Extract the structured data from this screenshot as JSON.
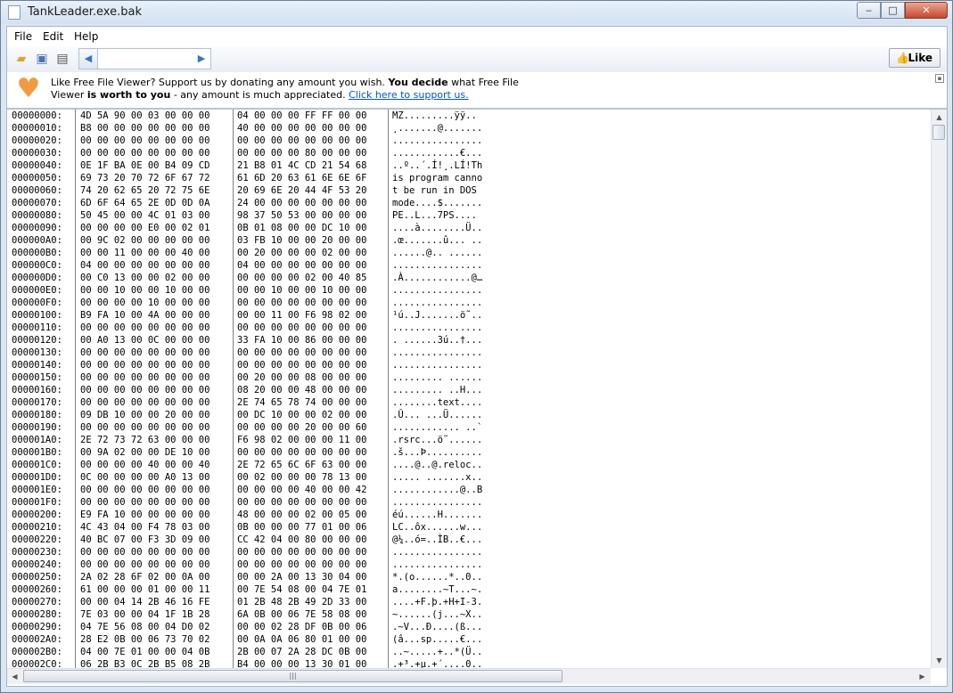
{
  "window": {
    "title": "TankLeader.exe.bak",
    "min": "‒",
    "max": "□",
    "close": "✕"
  },
  "menu": [
    "File",
    "Edit",
    "Help"
  ],
  "toolbar": {
    "like_label": "Like",
    "nav_prev": "◀",
    "nav_next": "▶"
  },
  "banner": {
    "p1": "Like Free File Viewer? Support us by donating any amount you wish.",
    "b1": "You decide",
    "p2": "what Free File",
    "p3": "Viewer",
    "b2": "is worth to you",
    "p4": "- any amount is much appreciated.",
    "link": "Click here to support us."
  },
  "hex_rows": [
    {
      "off": "00000000:",
      "h1": "4D 5A 90 00 03 00 00 00",
      "h2": "04 00 00 00 FF FF 00 00",
      "a": "MZ.........ÿÿ.."
    },
    {
      "off": "00000010:",
      "h1": "B8 00 00 00 00 00 00 00",
      "h2": "40 00 00 00 00 00 00 00",
      "a": "¸.......@......."
    },
    {
      "off": "00000020:",
      "h1": "00 00 00 00 00 00 00 00",
      "h2": "00 00 00 00 00 00 00 00",
      "a": "................"
    },
    {
      "off": "00000030:",
      "h1": "00 00 00 00 00 00 00 00",
      "h2": "00 00 00 00 80 00 00 00",
      "a": "............€..."
    },
    {
      "off": "00000040:",
      "h1": "0E 1F BA 0E 00 B4 09 CD",
      "h2": "21 B8 01 4C CD 21 54 68",
      "a": "..º..´.Í!¸.LÍ!Th"
    },
    {
      "off": "00000050:",
      "h1": "69 73 20 70 72 6F 67 72",
      "h2": "61 6D 20 63 61 6E 6E 6F",
      "a": "is program canno"
    },
    {
      "off": "00000060:",
      "h1": "74 20 62 65 20 72 75 6E",
      "h2": "20 69 6E 20 44 4F 53 20",
      "a": "t be run in DOS "
    },
    {
      "off": "00000070:",
      "h1": "6D 6F 64 65 2E 0D 0D 0A",
      "h2": "24 00 00 00 00 00 00 00",
      "a": "mode....$......."
    },
    {
      "off": "00000080:",
      "h1": "50 45 00 00 4C 01 03 00",
      "h2": "98 37 50 53 00 00 00 00",
      "a": "PE..L...7PS...."
    },
    {
      "off": "00000090:",
      "h1": "00 00 00 00 E0 00 02 01",
      "h2": "0B 01 08 00 00 DC 10 00",
      "a": "....à........Ü.."
    },
    {
      "off": "000000A0:",
      "h1": "00 9C 02 00 00 00 00 00",
      "h2": "03 FB 10 00 00 20 00 00",
      "a": ".œ.......û... .."
    },
    {
      "off": "000000B0:",
      "h1": "00 00 11 00 00 00 40 00",
      "h2": "00 20 00 00 00 02 00 00",
      "a": "......@.. ......"
    },
    {
      "off": "000000C0:",
      "h1": "04 00 00 00 00 00 00 00",
      "h2": "04 00 00 00 00 00 00 00",
      "a": "................"
    },
    {
      "off": "000000D0:",
      "h1": "00 C0 13 00 00 02 00 00",
      "h2": "00 00 00 00 02 00 40 85",
      "a": ".À............@…"
    },
    {
      "off": "000000E0:",
      "h1": "00 00 10 00 00 10 00 00",
      "h2": "00 00 10 00 00 10 00 00",
      "a": "................"
    },
    {
      "off": "000000F0:",
      "h1": "00 00 00 00 10 00 00 00",
      "h2": "00 00 00 00 00 00 00 00",
      "a": "................"
    },
    {
      "off": "00000100:",
      "h1": "B9 FA 10 00 4A 00 00 00",
      "h2": "00 00 11 00 F6 98 02 00",
      "a": "¹ú..J.......ö˜.."
    },
    {
      "off": "00000110:",
      "h1": "00 00 00 00 00 00 00 00",
      "h2": "00 00 00 00 00 00 00 00",
      "a": "................"
    },
    {
      "off": "00000120:",
      "h1": "00 A0 13 00 0C 00 00 00",
      "h2": "33 FA 10 00 86 00 00 00",
      "a": ". ......3ú..†..."
    },
    {
      "off": "00000130:",
      "h1": "00 00 00 00 00 00 00 00",
      "h2": "00 00 00 00 00 00 00 00",
      "a": "................"
    },
    {
      "off": "00000140:",
      "h1": "00 00 00 00 00 00 00 00",
      "h2": "00 00 00 00 00 00 00 00",
      "a": "................"
    },
    {
      "off": "00000150:",
      "h1": "00 00 00 00 00 00 00 00",
      "h2": "00 20 00 00 08 00 00 00",
      "a": "......... ......"
    },
    {
      "off": "00000160:",
      "h1": "00 00 00 00 00 00 00 00",
      "h2": "08 20 00 00 48 00 00 00",
      "a": "......... ..H..."
    },
    {
      "off": "00000170:",
      "h1": "00 00 00 00 00 00 00 00",
      "h2": "2E 74 65 78 74 00 00 00",
      "a": "........text...."
    },
    {
      "off": "00000180:",
      "h1": "09 DB 10 00 00 20 00 00",
      "h2": "00 DC 10 00 00 02 00 00",
      "a": ".Û... ...Ü......"
    },
    {
      "off": "00000190:",
      "h1": "00 00 00 00 00 00 00 00",
      "h2": "00 00 00 00 20 00 00 60",
      "a": "............ ..`"
    },
    {
      "off": "000001A0:",
      "h1": "2E 72 73 72 63 00 00 00",
      "h2": "F6 98 02 00 00 00 11 00",
      "a": ".rsrc...ö˜......"
    },
    {
      "off": "000001B0:",
      "h1": "00 9A 02 00 00 DE 10 00",
      "h2": "00 00 00 00 00 00 00 00",
      "a": ".š...Þ.........."
    },
    {
      "off": "000001C0:",
      "h1": "00 00 00 00 40 00 00 40",
      "h2": "2E 72 65 6C 6F 63 00 00",
      "a": "....@..@.reloc.."
    },
    {
      "off": "000001D0:",
      "h1": "0C 00 00 00 00 A0 13 00",
      "h2": "00 02 00 00 00 78 13 00",
      "a": "..... .......x.."
    },
    {
      "off": "000001E0:",
      "h1": "00 00 00 00 00 00 00 00",
      "h2": "00 00 00 00 40 00 00 42",
      "a": "............@..B"
    },
    {
      "off": "000001F0:",
      "h1": "00 00 00 00 00 00 00 00",
      "h2": "00 00 00 00 00 00 00 00",
      "a": "................"
    },
    {
      "off": "00000200:",
      "h1": "E9 FA 10 00 00 00 00 00",
      "h2": "48 00 00 00 02 00 05 00",
      "a": "éú......H......."
    },
    {
      "off": "00000210:",
      "h1": "4C 43 04 00 F4 78 03 00",
      "h2": "0B 00 00 00 77 01 00 06",
      "a": "LC..ôx......w..."
    },
    {
      "off": "00000220:",
      "h1": "40 BC 07 00 F3 3D 09 00",
      "h2": "CC 42 04 00 80 00 00 00",
      "a": "@¼..ó=..ÌB..€..."
    },
    {
      "off": "00000230:",
      "h1": "00 00 00 00 00 00 00 00",
      "h2": "00 00 00 00 00 00 00 00",
      "a": "................"
    },
    {
      "off": "00000240:",
      "h1": "00 00 00 00 00 00 00 00",
      "h2": "00 00 00 00 00 00 00 00",
      "a": "................"
    },
    {
      "off": "00000250:",
      "h1": "2A 02 28 6F 02 00 0A 00",
      "h2": "00 00 2A 00 13 30 04 00",
      "a": "*.(o......*..0.."
    },
    {
      "off": "00000260:",
      "h1": "61 00 00 00 01 00 00 11",
      "h2": "00 7E 54 08 00 04 7E 01",
      "a": "a........~T...~."
    },
    {
      "off": "00000270:",
      "h1": "00 00 04 14 2B 46 16 FE",
      "h2": "01 2B 48 2B 49 2D 33 00",
      "a": "....+F.þ.+H+I-3."
    },
    {
      "off": "00000280:",
      "h1": "7E 03 00 00 04 1F 1B 28",
      "h2": "6A 0B 00 06 7E 58 08 00",
      "a": "~......(j...~X.."
    },
    {
      "off": "00000290:",
      "h1": "04 7E 56 08 00 04 D0 02",
      "h2": "00 00 02 28 DF 0B 00 06",
      "a": ".~V...Ð....(ß..."
    },
    {
      "off": "000002A0:",
      "h1": "28 E2 0B 00 06 73 70 02",
      "h2": "00 0A 0A 06 80 01 00 00",
      "a": "(â...sp.....€..."
    },
    {
      "off": "000002B0:",
      "h1": "04 00 7E 01 00 00 04 0B",
      "h2": "2B 00 07 2A 28 DC 0B 00",
      "a": "..~.....+..*(Ü.."
    },
    {
      "off": "000002C0:",
      "h1": "06 2B B3 0C 2B B5 08 2B",
      "h2": "B4 00 00 00 13 30 01 00",
      "a": ".+³.+µ.+´....0.."
    }
  ]
}
